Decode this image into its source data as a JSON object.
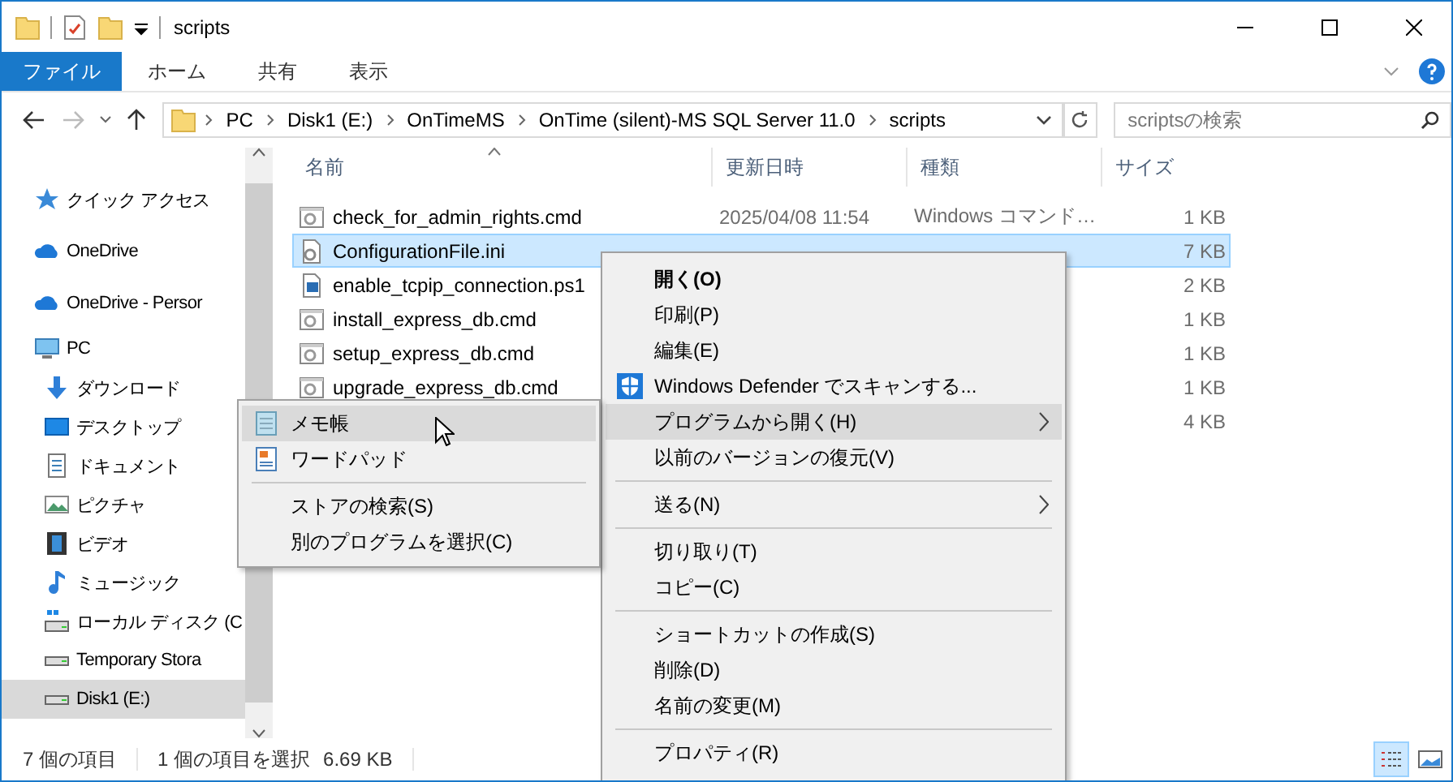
{
  "window": {
    "title": "scripts"
  },
  "ribbon": {
    "tabs": [
      {
        "label": "ファイル",
        "selected": true
      },
      {
        "label": "ホーム",
        "selected": false
      },
      {
        "label": "共有",
        "selected": false
      },
      {
        "label": "表示",
        "selected": false
      }
    ]
  },
  "address": {
    "crumbs": [
      "PC",
      "Disk1 (E:)",
      "OnTimeMS",
      "OnTime (silent)-MS SQL Server 11.0",
      "scripts"
    ],
    "search": {
      "placeholder": "scriptsの検索"
    }
  },
  "sidebar": {
    "items": [
      {
        "kind": "star",
        "label": "クイック アクセス",
        "selected": false
      },
      {
        "kind": "cloud",
        "label": "OneDrive",
        "selected": false
      },
      {
        "kind": "cloud",
        "label": "OneDrive - Persor",
        "selected": false
      },
      {
        "kind": "pc",
        "label": "PC",
        "selected": false,
        "children": [
          {
            "kind": "download",
            "label": "ダウンロード",
            "selected": false
          },
          {
            "kind": "desktop",
            "label": "デスクトップ",
            "selected": false
          },
          {
            "kind": "docs",
            "label": "ドキュメント",
            "selected": false
          },
          {
            "kind": "pictures",
            "label": "ピクチャ",
            "selected": false
          },
          {
            "kind": "video",
            "label": "ビデオ",
            "selected": false
          },
          {
            "kind": "music",
            "label": "ミュージック",
            "selected": false
          },
          {
            "kind": "drive-c",
            "label": "ローカル ディスク (C",
            "selected": false
          },
          {
            "kind": "drive",
            "label": "Temporary Stora",
            "selected": false
          },
          {
            "kind": "drive",
            "label": "Disk1 (E:)",
            "selected": true
          }
        ]
      }
    ]
  },
  "file_list": {
    "columns": [
      "名前",
      "更新日時",
      "種類",
      "サイズ"
    ],
    "rows": [
      {
        "kind": "cmd",
        "name": "check_for_admin_rights.cmd",
        "date": "2025/04/08 11:54",
        "type": "Windows コマンド…",
        "size": "1 KB",
        "selected": false
      },
      {
        "kind": "ini",
        "name": "ConfigurationFile.ini",
        "size": "7 KB",
        "selected": true
      },
      {
        "kind": "ps1",
        "name": "enable_tcpip_connection.ps1",
        "size": "2 KB",
        "selected": false
      },
      {
        "kind": "cmd",
        "name": "install_express_db.cmd",
        "size": "1 KB",
        "selected": false
      },
      {
        "kind": "cmd",
        "name": "setup_express_db.cmd",
        "size": "1 KB",
        "selected": false
      },
      {
        "kind": "cmd",
        "name": "upgrade_express_db.cmd",
        "size": "1 KB",
        "selected": false
      },
      {
        "kind": "hidden",
        "size": "4 KB",
        "selected": false
      }
    ]
  },
  "context_menu": {
    "items": [
      {
        "kind": "item",
        "label": "開く(O)",
        "default": true,
        "selected": false
      },
      {
        "kind": "item",
        "label": "印刷(P)",
        "selected": false
      },
      {
        "kind": "item",
        "label": "編集(E)",
        "selected": false
      },
      {
        "kind": "shield-item",
        "label": "Windows Defender でスキャンする...",
        "selected": false
      },
      {
        "kind": "submenu-item",
        "label": "プログラムから開く(H)",
        "selected": true
      },
      {
        "kind": "item",
        "label": "以前のバージョンの復元(V)",
        "selected": false
      },
      {
        "kind": "separator"
      },
      {
        "kind": "submenu-item",
        "label": "送る(N)",
        "selected": false
      },
      {
        "kind": "separator"
      },
      {
        "kind": "item",
        "label": "切り取り(T)",
        "selected": false
      },
      {
        "kind": "item",
        "label": "コピー(C)",
        "selected": false
      },
      {
        "kind": "separator"
      },
      {
        "kind": "item",
        "label": "ショートカットの作成(S)",
        "selected": false
      },
      {
        "kind": "item",
        "label": "削除(D)",
        "selected": false
      },
      {
        "kind": "item",
        "label": "名前の変更(M)",
        "selected": false
      },
      {
        "kind": "separator"
      },
      {
        "kind": "item",
        "label": "プロパティ(R)",
        "selected": false
      }
    ]
  },
  "open_with_menu": {
    "items": [
      {
        "kind": "notepad",
        "label": "メモ帳",
        "selected": true
      },
      {
        "kind": "wordpad",
        "label": "ワードパッド",
        "selected": false
      },
      {
        "kind": "separator"
      },
      {
        "kind": "item",
        "label": "ストアの検索(S)",
        "selected": false
      },
      {
        "kind": "item",
        "label": "別のプログラムを選択(C)",
        "selected": false
      }
    ]
  },
  "status_bar": {
    "item_count": "7 個の項目",
    "selection": "1 個の項目を選択",
    "selection_size": "6.69 KB",
    "views": [
      {
        "kind": "details",
        "selected": true
      },
      {
        "kind": "thumbnails",
        "selected": false
      }
    ]
  }
}
